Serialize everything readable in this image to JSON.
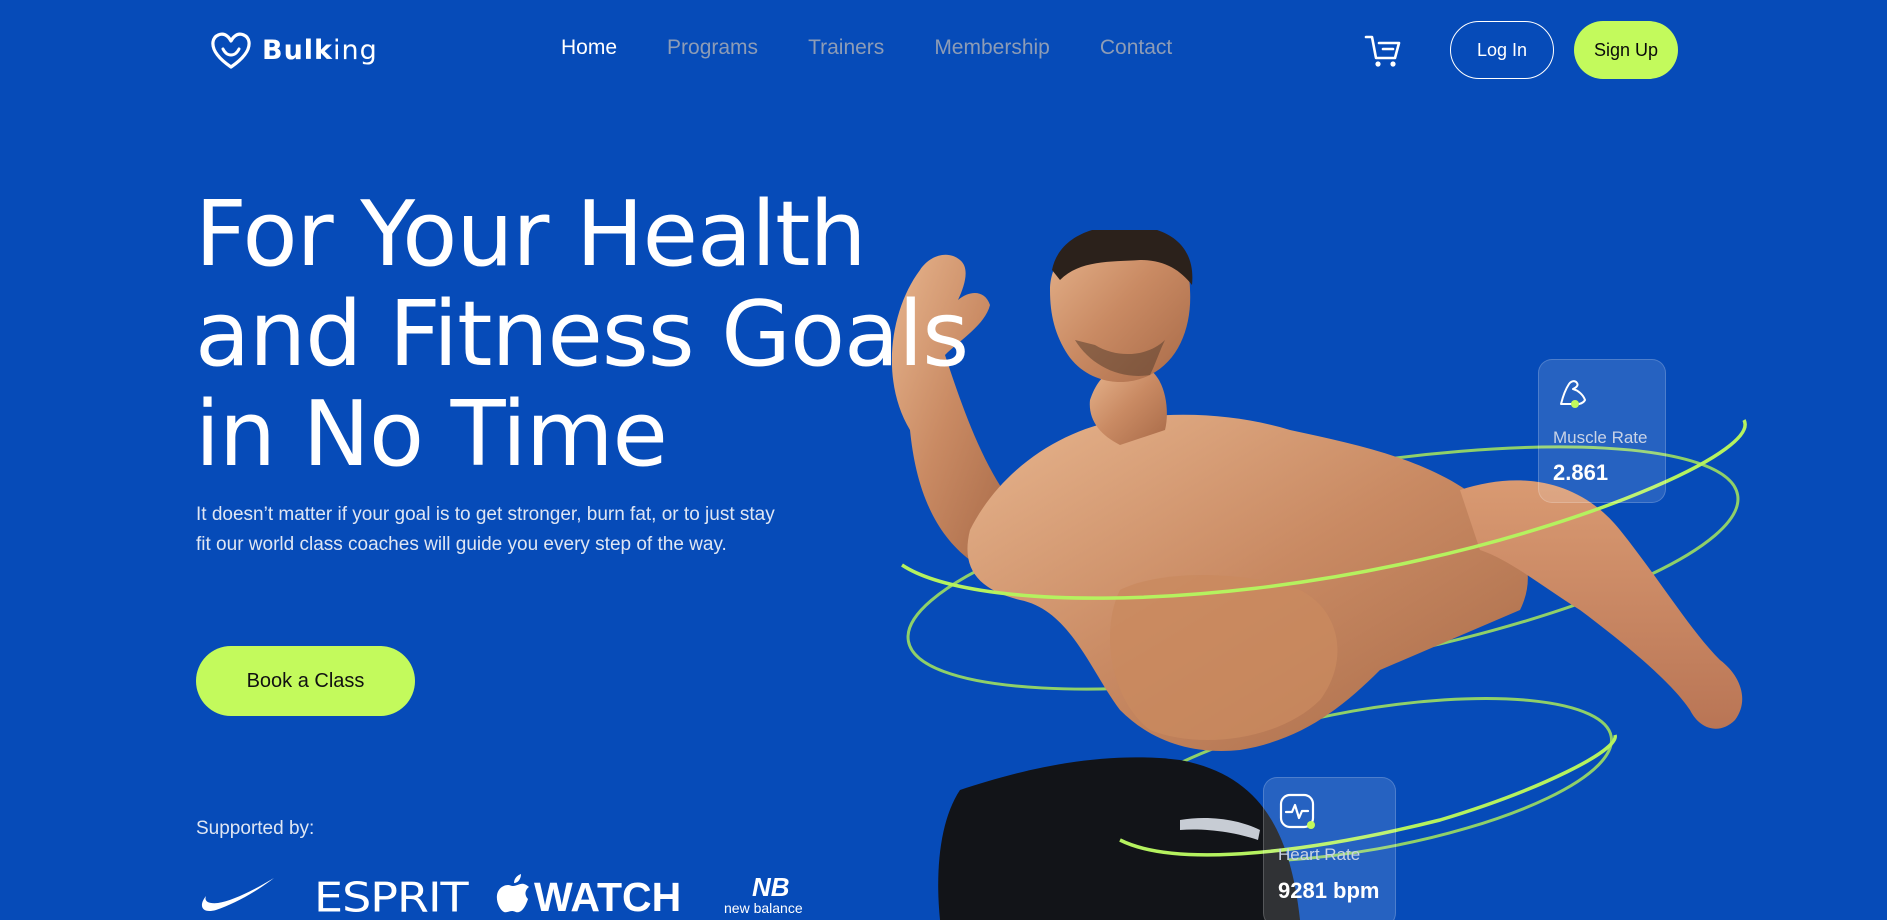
{
  "brand": {
    "name_bold": "Bulk",
    "name_light": "ing",
    "icon": "heart-outline-icon"
  },
  "nav": {
    "links": [
      {
        "label": "Home",
        "active": true
      },
      {
        "label": "Programs",
        "active": false
      },
      {
        "label": "Trainers",
        "active": false
      },
      {
        "label": "Membership",
        "active": false
      },
      {
        "label": "Contact",
        "active": false
      }
    ],
    "cart_icon": "shopping-cart-icon",
    "login_label": "Log In",
    "signup_label": "Sign Up"
  },
  "hero": {
    "title_lines": [
      "For Your Health",
      "and Fitness Goals",
      "in No Time"
    ],
    "description": "It doesn’t matter if your goal is to get stronger, burn fat, or to just stay fit our world class coaches will guide you every step of the way.",
    "cta_label": "Book a Class"
  },
  "supported": {
    "label": "Supported by:",
    "brands": [
      {
        "name": "Nike",
        "kind": "nike-swoosh-logo"
      },
      {
        "name": "ESPRIT",
        "kind": "esprit-logo"
      },
      {
        "name": "WATCH",
        "kind": "apple-watch-logo"
      },
      {
        "name": "new balance",
        "kind": "new-balance-logo"
      }
    ]
  },
  "stats": {
    "muscle": {
      "label": "Muscle Rate",
      "value": "2.861",
      "icon": "flexed-arm-icon"
    },
    "heart": {
      "label": "Heart Rate",
      "value": "9281 bpm",
      "icon": "heart-pulse-icon"
    }
  },
  "colors": {
    "background": "#064bb8",
    "accent": "#c3fa5c",
    "nav_inactive": "#8d9cb6",
    "text_primary": "#ffffff"
  }
}
